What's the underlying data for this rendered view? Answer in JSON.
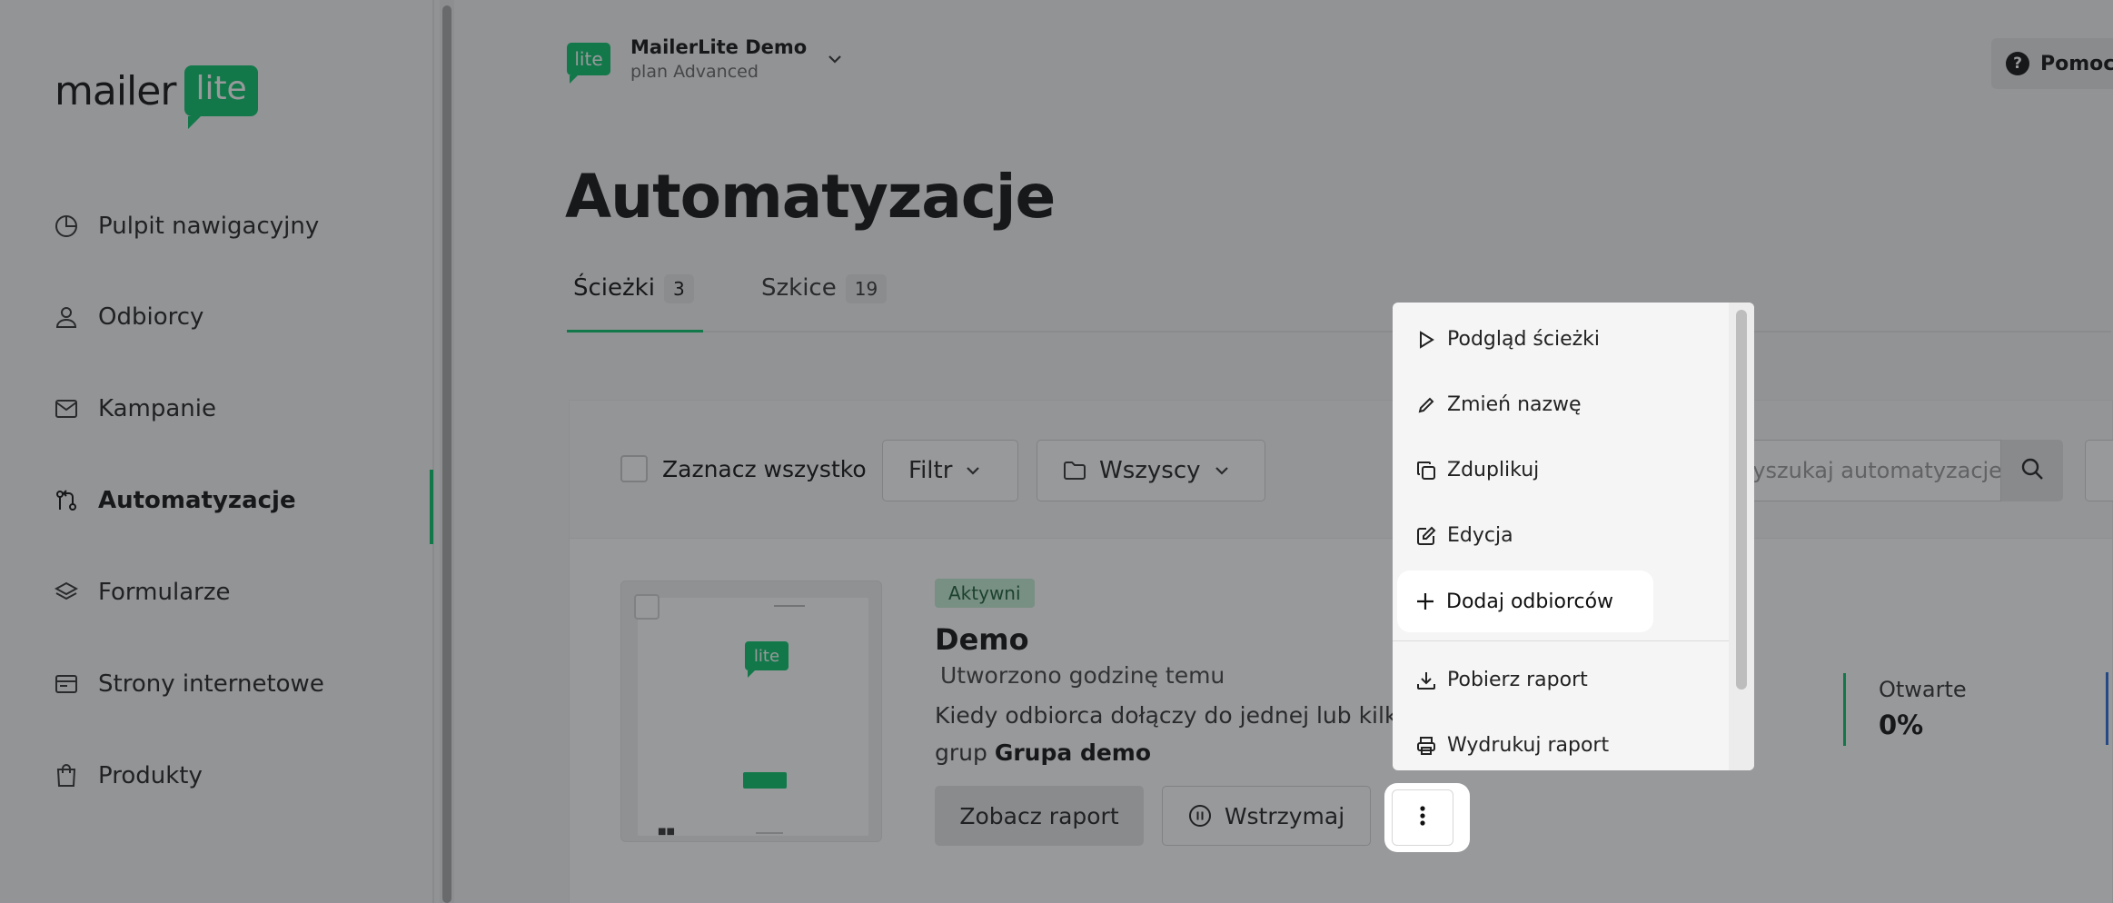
{
  "brand": {
    "word": "mailer",
    "badge": "lite",
    "accent_color": "#09c269"
  },
  "sidebar": {
    "items": [
      {
        "label": "Pulpit nawigacyjny",
        "icon": "dashboard-icon"
      },
      {
        "label": "Odbiorcy",
        "icon": "user-icon"
      },
      {
        "label": "Kampanie",
        "icon": "mail-icon"
      },
      {
        "label": "Automatyzacje",
        "icon": "automation-icon",
        "active": true
      },
      {
        "label": "Formularze",
        "icon": "layers-icon"
      },
      {
        "label": "Strony internetowe",
        "icon": "website-icon"
      },
      {
        "label": "Produkty",
        "icon": "shopping-bag-icon"
      }
    ]
  },
  "account": {
    "logo_text": "lite",
    "name": "MailerLite Demo",
    "plan": "plan Advanced"
  },
  "help": {
    "label": "Pomoc"
  },
  "page": {
    "title": "Automatyzacje"
  },
  "tabs": [
    {
      "label": "Ścieżki",
      "count": "3",
      "active": true
    },
    {
      "label": "Szkice",
      "count": "19",
      "active": false
    }
  ],
  "toolbar": {
    "select_all_label": "Zaznacz wszystko",
    "filter_label": "Filtr",
    "folder_label": "Wszyscy",
    "search_placeholder": "Wyszukaj automatyzacje"
  },
  "automation": {
    "thumb_logo": "lite",
    "status": "Aktywni",
    "title": "Demo",
    "created": "Utworzono godzinę temu",
    "description_line1": "Kiedy odbiorca dołączy do jednej lub kilku",
    "description_prefix": "grup",
    "description_group": "Grupa demo",
    "report_button": "Zobacz raport",
    "pause_button": "Wstrzymaj",
    "stats": {
      "opened_label": "Otwarte",
      "opened_value": "0%"
    }
  },
  "menu": {
    "items": [
      {
        "label": "Podgląd ścieżki",
        "icon": "play-icon"
      },
      {
        "label": "Zmień nazwę",
        "icon": "pencil-icon"
      },
      {
        "label": "Zduplikuj",
        "icon": "duplicate-icon"
      },
      {
        "label": "Edycja",
        "icon": "edit-icon"
      },
      {
        "label": "Dodaj odbiorców",
        "icon": "plus-icon",
        "highlighted": true
      },
      {
        "label": "Pobierz raport",
        "icon": "download-icon"
      },
      {
        "label": "Wydrukuj raport",
        "icon": "printer-icon"
      }
    ]
  }
}
